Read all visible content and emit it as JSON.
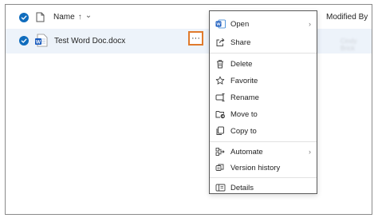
{
  "header": {
    "name_label": "Name",
    "sort_arrow": "↑",
    "sort_chevron": "⌄",
    "modified_by_label": "Modified By",
    "modified_by_chevron": "⌄"
  },
  "file": {
    "name": "Test Word Doc.docx",
    "more_glyph": "···",
    "modified_by_blurred": "Cindy Brick"
  },
  "menu": {
    "items": [
      {
        "label": "Open",
        "icon": "word-icon",
        "submenu": true
      },
      {
        "label": "Share",
        "icon": "share-icon",
        "submenu": false
      },
      {
        "label": "Delete",
        "icon": "trash-icon",
        "submenu": false
      },
      {
        "label": "Favorite",
        "icon": "star-icon",
        "submenu": false
      },
      {
        "label": "Rename",
        "icon": "rename-icon",
        "submenu": false
      },
      {
        "label": "Move to",
        "icon": "move-icon",
        "submenu": false
      },
      {
        "label": "Copy to",
        "icon": "copy-icon",
        "submenu": false
      },
      {
        "label": "Automate",
        "icon": "automate-icon",
        "submenu": true
      },
      {
        "label": "Version history",
        "icon": "history-icon",
        "submenu": false
      },
      {
        "label": "Details",
        "icon": "details-icon",
        "submenu": false
      }
    ],
    "submenu_glyph": "›"
  },
  "colors": {
    "accent": "#0f6cbd",
    "callout": "#e07a2c",
    "row_selected": "#edf3fa"
  }
}
